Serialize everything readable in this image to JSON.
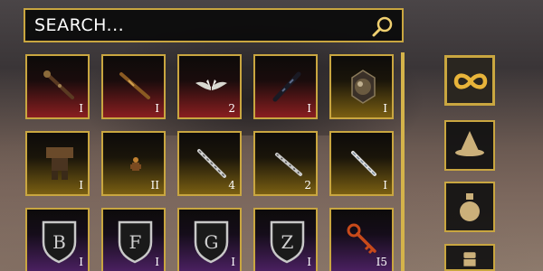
{
  "search": {
    "placeholder": "SEARCH..."
  },
  "inventory": {
    "slots": [
      {
        "icon": "staff-icon",
        "quantity": "I",
        "rarity": "red"
      },
      {
        "icon": "wand-icon",
        "quantity": "I",
        "rarity": "red"
      },
      {
        "icon": "wings-icon",
        "quantity": "2",
        "rarity": "red"
      },
      {
        "icon": "dark-wand-icon",
        "quantity": "I",
        "rarity": "red"
      },
      {
        "icon": "orb-cage-icon",
        "quantity": "I",
        "rarity": "yellow"
      },
      {
        "icon": "armor-icon",
        "quantity": "I",
        "rarity": "yellow"
      },
      {
        "icon": "small-figure-icon",
        "quantity": "II",
        "rarity": "yellow"
      },
      {
        "icon": "silver-wand-icon",
        "quantity": "4",
        "rarity": "yellow"
      },
      {
        "icon": "silver-wand-icon",
        "quantity": "2",
        "rarity": "yellow"
      },
      {
        "icon": "silver-wand-icon",
        "quantity": "I",
        "rarity": "yellow"
      },
      {
        "icon": "shield-letter-icon",
        "letter": "B",
        "quantity": "I",
        "rarity": "purple"
      },
      {
        "icon": "shield-letter-icon",
        "letter": "F",
        "quantity": "I",
        "rarity": "purple"
      },
      {
        "icon": "shield-letter-icon",
        "letter": "G",
        "quantity": "I",
        "rarity": "purple"
      },
      {
        "icon": "shield-letter-icon",
        "letter": "Z",
        "quantity": "I",
        "rarity": "purple"
      },
      {
        "icon": "key-icon",
        "quantity": "I5",
        "rarity": "purple"
      }
    ]
  },
  "categories": [
    {
      "icon": "infinity-icon",
      "active": true
    },
    {
      "icon": "wizard-hat-icon",
      "active": false
    },
    {
      "icon": "potion-icon",
      "active": false
    },
    {
      "icon": "chest-icon",
      "active": false
    }
  ],
  "colors": {
    "gold": "#c9a640",
    "red": "#8a1e20",
    "yellow": "#7a5f12",
    "purple": "#4a2060"
  }
}
